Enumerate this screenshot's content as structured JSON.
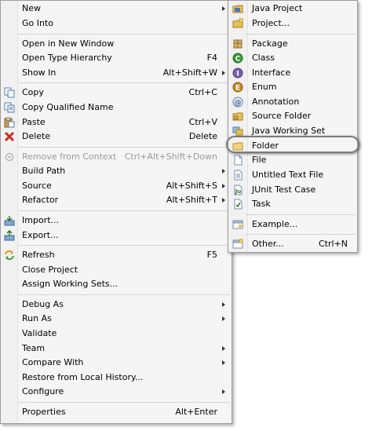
{
  "main_menu": {
    "items": [
      {
        "label": "New",
        "accel": "",
        "submenu": true,
        "icon": ""
      },
      {
        "label": "Go Into",
        "accel": "",
        "submenu": false,
        "icon": ""
      },
      {
        "label": "Open in New Window",
        "accel": "",
        "submenu": false,
        "icon": ""
      },
      {
        "label": "Open Type Hierarchy",
        "accel": "F4",
        "submenu": false,
        "icon": ""
      },
      {
        "label": "Show In",
        "accel": "Alt+Shift+W",
        "submenu": true,
        "icon": ""
      },
      {
        "label": "Copy",
        "accel": "Ctrl+C",
        "submenu": false,
        "icon": "copy-icon"
      },
      {
        "label": "Copy Qualified Name",
        "accel": "",
        "submenu": false,
        "icon": "copy-qualified-icon"
      },
      {
        "label": "Paste",
        "accel": "Ctrl+V",
        "submenu": false,
        "icon": "paste-icon"
      },
      {
        "label": "Delete",
        "accel": "Delete",
        "submenu": false,
        "icon": "delete-icon"
      },
      {
        "label": "Remove from Context",
        "accel": "Ctrl+Alt+Shift+Down",
        "submenu": false,
        "icon": "remove-context-icon",
        "disabled": true
      },
      {
        "label": "Build Path",
        "accel": "",
        "submenu": true,
        "icon": ""
      },
      {
        "label": "Source",
        "accel": "Alt+Shift+S",
        "submenu": true,
        "icon": ""
      },
      {
        "label": "Refactor",
        "accel": "Alt+Shift+T",
        "submenu": true,
        "icon": ""
      },
      {
        "label": "Import...",
        "accel": "",
        "submenu": false,
        "icon": "import-icon"
      },
      {
        "label": "Export...",
        "accel": "",
        "submenu": false,
        "icon": "export-icon"
      },
      {
        "label": "Refresh",
        "accel": "F5",
        "submenu": false,
        "icon": "refresh-icon"
      },
      {
        "label": "Close Project",
        "accel": "",
        "submenu": false,
        "icon": ""
      },
      {
        "label": "Assign Working Sets...",
        "accel": "",
        "submenu": false,
        "icon": ""
      },
      {
        "label": "Debug As",
        "accel": "",
        "submenu": true,
        "icon": ""
      },
      {
        "label": "Run As",
        "accel": "",
        "submenu": true,
        "icon": ""
      },
      {
        "label": "Validate",
        "accel": "",
        "submenu": false,
        "icon": ""
      },
      {
        "label": "Team",
        "accel": "",
        "submenu": true,
        "icon": ""
      },
      {
        "label": "Compare With",
        "accel": "",
        "submenu": true,
        "icon": ""
      },
      {
        "label": "Restore from Local History...",
        "accel": "",
        "submenu": false,
        "icon": ""
      },
      {
        "label": "Configure",
        "accel": "",
        "submenu": true,
        "icon": ""
      },
      {
        "label": "Properties",
        "accel": "Alt+Enter",
        "submenu": false,
        "icon": ""
      }
    ]
  },
  "new_submenu": {
    "items": [
      {
        "label": "Java Project",
        "accel": "",
        "icon": "java-project-icon"
      },
      {
        "label": "Project...",
        "accel": "",
        "icon": "project-icon"
      },
      {
        "label": "Package",
        "accel": "",
        "icon": "package-icon"
      },
      {
        "label": "Class",
        "accel": "",
        "icon": "class-icon"
      },
      {
        "label": "Interface",
        "accel": "",
        "icon": "interface-icon"
      },
      {
        "label": "Enum",
        "accel": "",
        "icon": "enum-icon"
      },
      {
        "label": "Annotation",
        "accel": "",
        "icon": "annotation-icon"
      },
      {
        "label": "Source Folder",
        "accel": "",
        "icon": "source-folder-icon"
      },
      {
        "label": "Java Working Set",
        "accel": "",
        "icon": "working-set-icon"
      },
      {
        "label": "Folder",
        "accel": "",
        "icon": "folder-icon"
      },
      {
        "label": "File",
        "accel": "",
        "icon": "file-icon"
      },
      {
        "label": "Untitled Text File",
        "accel": "",
        "icon": "text-file-icon"
      },
      {
        "label": "JUnit Test Case",
        "accel": "",
        "icon": "junit-icon"
      },
      {
        "label": "Task",
        "accel": "",
        "icon": "task-icon"
      },
      {
        "label": "Example...",
        "accel": "",
        "icon": "example-icon"
      },
      {
        "label": "Other...",
        "accel": "Ctrl+N",
        "icon": "other-icon"
      }
    ]
  },
  "colors": {
    "menu_bg": "#f5f5f5",
    "border": "#9d9d9d",
    "disabled_text": "#9b9b9b",
    "highlight_ring": "#7a7a7a"
  }
}
